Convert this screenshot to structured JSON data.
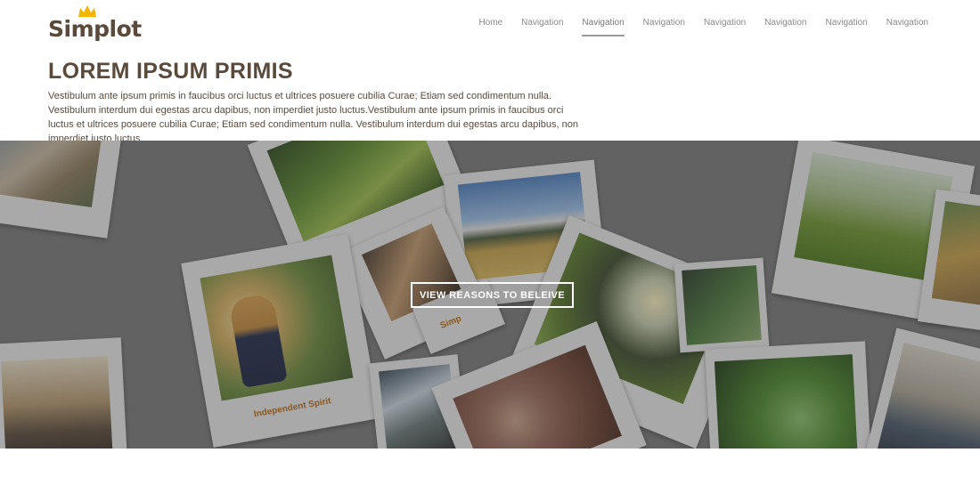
{
  "brand": {
    "name": "Simplot",
    "primary_color": "#5a4a3c",
    "crown_color": "#f2b705"
  },
  "nav": {
    "items": [
      {
        "label": "Home",
        "active": false
      },
      {
        "label": "Navigation",
        "active": false
      },
      {
        "label": "Navigation",
        "active": true
      },
      {
        "label": "Navigation",
        "active": false
      },
      {
        "label": "Navigation",
        "active": false
      },
      {
        "label": "Navigation",
        "active": false
      },
      {
        "label": "Navigation",
        "active": false
      },
      {
        "label": "Navigation",
        "active": false
      }
    ]
  },
  "intro": {
    "title": "LOREM IPSUM PRIMIS",
    "body": "Vestibulum ante ipsum primis in faucibus orci luctus et ultrices posuere cubilia Curae; Etiam sed condimentum nulla. Vestibulum interdum dui egestas arcu dapibus, non imperdiet justo luctus.Vestibulum ante ipsum primis in faucibus orci luctus et ultrices posuere cubilia Curae; Etiam sed condimentum nulla. Vestibulum interdum dui egestas arcu dapibus, non imperdiet justo luctus."
  },
  "hero": {
    "cta_label": "VIEW REASONS TO BELEIVE",
    "captions": {
      "girl": "Independent Spirit",
      "partial": "Simp"
    }
  }
}
